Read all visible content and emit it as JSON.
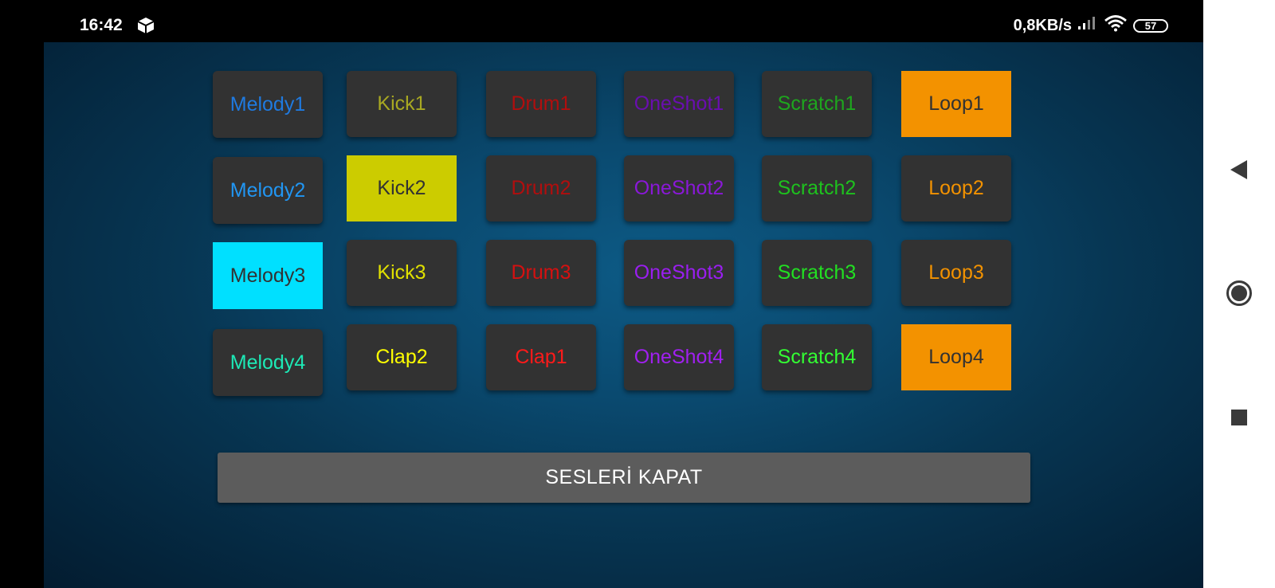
{
  "status_bar": {
    "time": "16:42",
    "app_icon": "package-icon",
    "network_speed": "0,8KB/s",
    "signal_icon": "cellular-signal-icon",
    "wifi_icon": "wifi-icon",
    "battery_level": "57"
  },
  "pads": [
    {
      "id": "melody1",
      "label": "Melody1",
      "color": "#1f7ae0",
      "active": false
    },
    {
      "id": "kick1",
      "label": "Kick1",
      "color": "#a8a822",
      "active": false
    },
    {
      "id": "drum1",
      "label": "Drum1",
      "color": "#b10e0e",
      "active": false
    },
    {
      "id": "oneshot1",
      "label": "OneShot1",
      "color": "#6a0eb0",
      "active": false
    },
    {
      "id": "scratch1",
      "label": "Scratch1",
      "color": "#1ea61e",
      "active": false
    },
    {
      "id": "loop1",
      "label": "Loop1",
      "color": "#323232",
      "active": true,
      "bg": "#f39200"
    },
    {
      "id": "melody2",
      "label": "Melody2",
      "color": "#2196f3",
      "active": false
    },
    {
      "id": "kick2",
      "label": "Kick2",
      "color": "#323232",
      "active": true,
      "bg": "#cccc00"
    },
    {
      "id": "drum2",
      "label": "Drum2",
      "color": "#b10e0e",
      "active": false
    },
    {
      "id": "oneshot2",
      "label": "OneShot2",
      "color": "#8a18d8",
      "active": false
    },
    {
      "id": "scratch2",
      "label": "Scratch2",
      "color": "#1ec11e",
      "active": false
    },
    {
      "id": "loop2",
      "label": "Loop2",
      "color": "#f39200",
      "active": false
    },
    {
      "id": "melody3",
      "label": "Melody3",
      "color": "#323232",
      "active": true,
      "bg": "#00e0ff"
    },
    {
      "id": "kick3",
      "label": "Kick3",
      "color": "#e0e000",
      "active": false
    },
    {
      "id": "drum3",
      "label": "Drum3",
      "color": "#d61010",
      "active": false
    },
    {
      "id": "oneshot3",
      "label": "OneShot3",
      "color": "#9a1ef0",
      "active": false
    },
    {
      "id": "scratch3",
      "label": "Scratch3",
      "color": "#22e022",
      "active": false
    },
    {
      "id": "loop3",
      "label": "Loop3",
      "color": "#f39200",
      "active": false
    },
    {
      "id": "melody4",
      "label": "Melody4",
      "color": "#1de9b6",
      "active": false
    },
    {
      "id": "clap2",
      "label": "Clap2",
      "color": "#ffff00",
      "active": false
    },
    {
      "id": "clap1",
      "label": "Clap1",
      "color": "#ff1a1a",
      "active": false
    },
    {
      "id": "oneshot4",
      "label": "OneShot4",
      "color": "#a020f0",
      "active": false
    },
    {
      "id": "scratch4",
      "label": "Scratch4",
      "color": "#33ff33",
      "active": false
    },
    {
      "id": "loop4",
      "label": "Loop4",
      "color": "#323232",
      "active": true,
      "bg": "#f39200"
    }
  ],
  "mute_button": {
    "label": "SESLERİ KAPAT"
  },
  "nav_bar": {
    "back_icon": "back-triangle-icon",
    "home_icon": "home-circle-icon",
    "recents_icon": "recents-square-icon"
  }
}
